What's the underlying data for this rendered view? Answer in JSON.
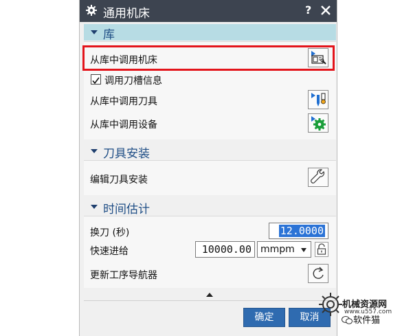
{
  "dialog": {
    "title": "通用机床",
    "help_label": "?",
    "icons": {
      "title": "gear-icon",
      "close": "close-icon"
    }
  },
  "sections": {
    "library": {
      "header": "库",
      "call_machine_label": "从库中调用机床",
      "call_slot_info_label": "调用刀槽信息",
      "call_slot_info_checked": true,
      "call_tool_label": "从库中调用刀具",
      "call_device_label": "从库中调用设备",
      "icons": {
        "machine": "machine-library-icon",
        "tool": "tool-library-icon",
        "device": "device-library-icon"
      }
    },
    "tool_mount": {
      "header": "刀具安装",
      "edit_label": "编辑刀具安装",
      "icon": "wrench-icon"
    },
    "time_estimate": {
      "header": "时间估计",
      "tool_change_label": "换刀 (秒)",
      "tool_change_value": "12.0000",
      "rapid_feed_label": "快速进给",
      "rapid_feed_value": "10000.00",
      "rapid_feed_unit": "mmpm",
      "update_nav_label": "更新工序导航器",
      "icons": {
        "lock": "lock-icon",
        "refresh": "refresh-icon"
      }
    }
  },
  "footer": {
    "ok_label": "确定",
    "cancel_label": "取消"
  },
  "watermark": {
    "line1": "机械资源网",
    "line2": "www.u557.com",
    "line3": "软件猫"
  },
  "colors": {
    "titlebar": "#3d4450",
    "section_header_active": "#b7dce4",
    "section_text": "#1e4d85",
    "highlight": "#e3141b",
    "button": "#2f6bb0"
  }
}
